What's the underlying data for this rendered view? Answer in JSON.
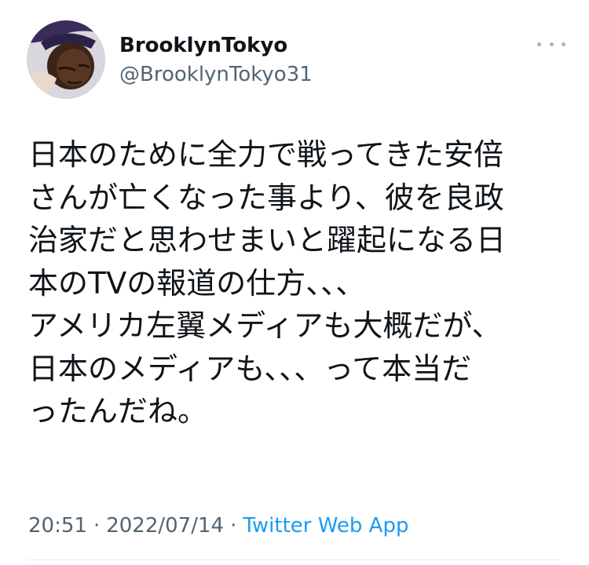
{
  "author": {
    "display_name": "BrooklynTokyo",
    "handle": "@BrooklynTokyo31",
    "avatar_icon": "profile-photo"
  },
  "menu": {
    "icon": "more-icon"
  },
  "tweet": {
    "lines": [
      "日本のために全力で戦ってきた安倍",
      "さんが亡くなった事より、彼を良政",
      "治家だと思わせまいと躍起になる日",
      "本のTVの報道の仕方、、、",
      "アメリカ左翼メディアも大概だが、",
      "日本のメディアも、、、って本当だ",
      "ったんだね。"
    ]
  },
  "meta": {
    "time": "20:51",
    "separator": "·",
    "date": "2022/07/14",
    "source": "Twitter Web App"
  },
  "colors": {
    "text": "#0f1419",
    "secondary": "#536471",
    "link": "#1d9bf0"
  }
}
